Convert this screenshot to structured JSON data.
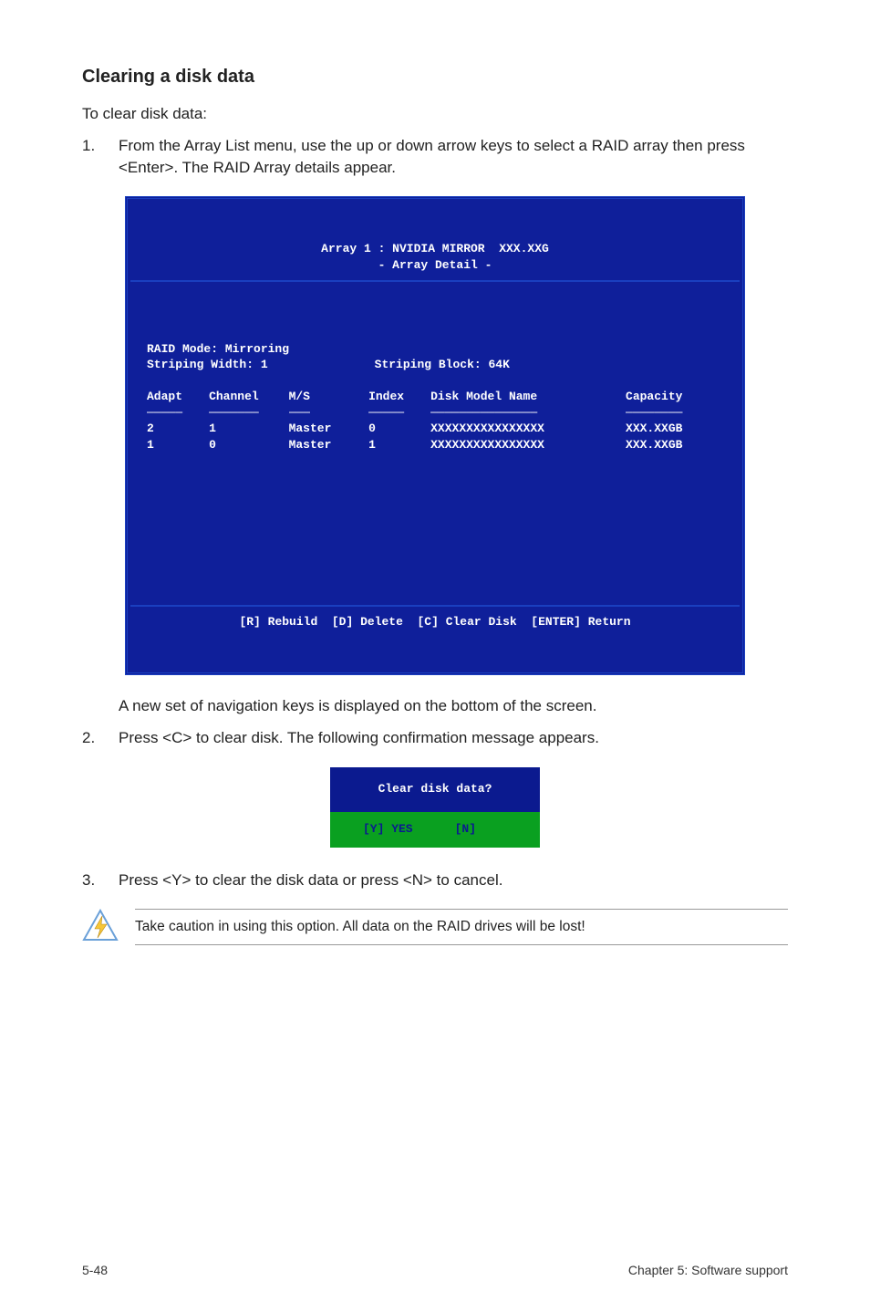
{
  "heading": "Clearing a disk data",
  "intro": "To clear disk data:",
  "steps": [
    "From the Array List menu, use the up or down arrow keys to select a RAID array then press <Enter>. The RAID Array details appear.",
    "Press <C> to clear disk. The following confirmation message appears.",
    "Press <Y> to clear the disk data or press <N> to cancel."
  ],
  "mid_note": "A new set of  navigation keys is displayed on the bottom of the screen.",
  "bios": {
    "title_line1": "Array 1 : NVIDIA MIRROR  XXX.XXG",
    "title_line2": "- Array Detail -",
    "raid_mode": "RAID Mode: Mirroring",
    "striping_width": "Striping Width: 1",
    "striping_block": "Striping Block: 64K",
    "headers": {
      "adapt": "Adapt",
      "channel": "Channel",
      "ms": "M/S",
      "index": "Index",
      "model": "Disk Model Name",
      "capacity": "Capacity"
    },
    "rows": [
      {
        "adapt": "2",
        "channel": "1",
        "ms": "Master",
        "index": "0",
        "model": "XXXXXXXXXXXXXXXX",
        "capacity": "XXX.XXGB"
      },
      {
        "adapt": "1",
        "channel": "0",
        "ms": "Master",
        "index": "1",
        "model": "XXXXXXXXXXXXXXXX",
        "capacity": "XXX.XXGB"
      }
    ],
    "footer": "[R] Rebuild  [D] Delete  [C] Clear Disk  [ENTER] Return"
  },
  "dialog": {
    "question": "Clear disk data?",
    "yes": "[Y] YES",
    "no": "[N]"
  },
  "caution_text": "Take caution in using this option. All data on the RAID drives will be lost!",
  "footer_left": "5-48",
  "footer_right": "Chapter 5: Software support"
}
